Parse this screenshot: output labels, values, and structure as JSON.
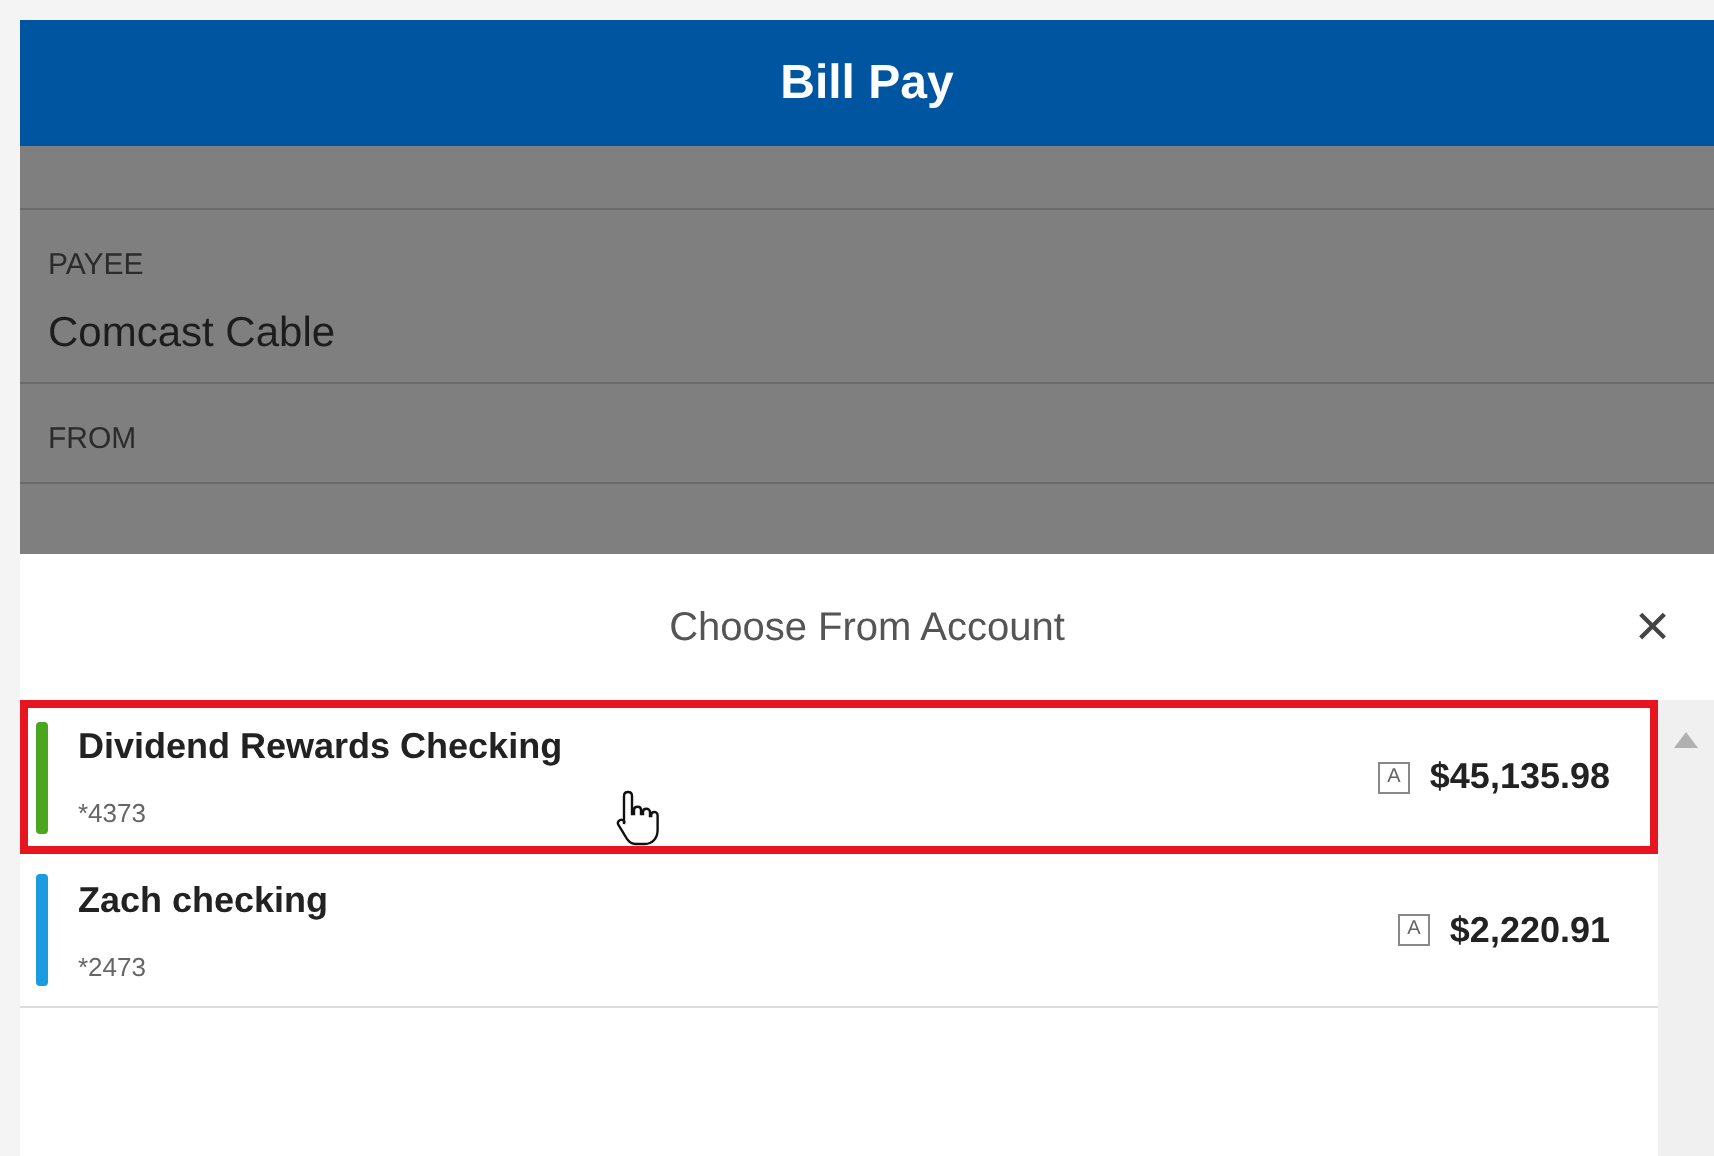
{
  "header": {
    "title": "Bill Pay"
  },
  "form": {
    "fields": [
      {
        "label": "PAYEE",
        "value": "Comcast Cable"
      },
      {
        "label": "FROM"
      }
    ]
  },
  "sheet": {
    "title": "Choose From Account",
    "close": "×"
  },
  "accounts": [
    {
      "name": "Dividend Rewards Checking",
      "number": "*4373",
      "badge": "A",
      "balance": "$45,135.98",
      "color": "#4aa61f",
      "highlighted": true
    },
    {
      "name": "Zach checking",
      "number": "*2473",
      "badge": "A",
      "balance": "$2,220.91",
      "color": "#1b9be0",
      "highlighted": false
    }
  ]
}
